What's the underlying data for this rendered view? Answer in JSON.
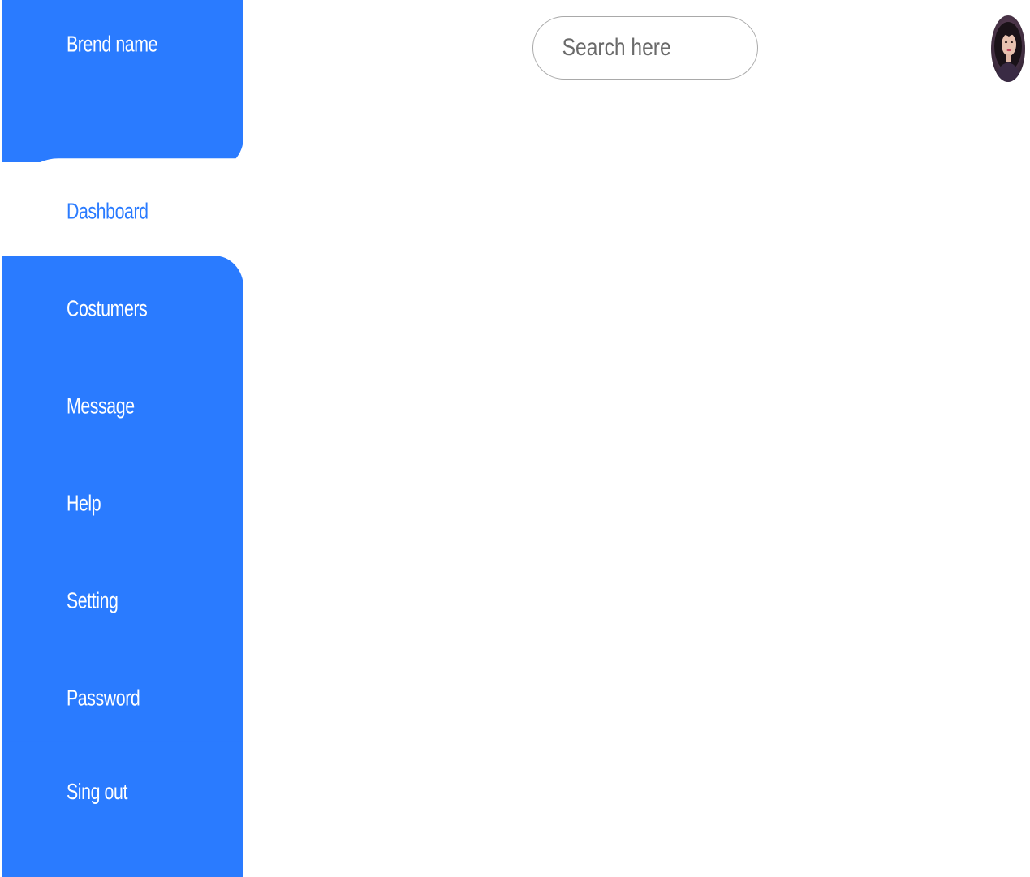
{
  "sidebar": {
    "brand": "Brend name",
    "items": [
      {
        "label": "Dashboard"
      },
      {
        "label": "Costumers"
      },
      {
        "label": "Message"
      },
      {
        "label": "Help"
      },
      {
        "label": "Setting"
      },
      {
        "label": "Password"
      },
      {
        "label": "Sing out"
      }
    ],
    "active_index": 0
  },
  "header": {
    "search": {
      "placeholder": "Search here",
      "value": ""
    },
    "avatar_icon": "user-avatar-photo"
  },
  "colors": {
    "accent": "#2a7bff",
    "background": "#ffffff",
    "text_on_accent": "#ffffff",
    "search_border": "#a9a9a9"
  }
}
